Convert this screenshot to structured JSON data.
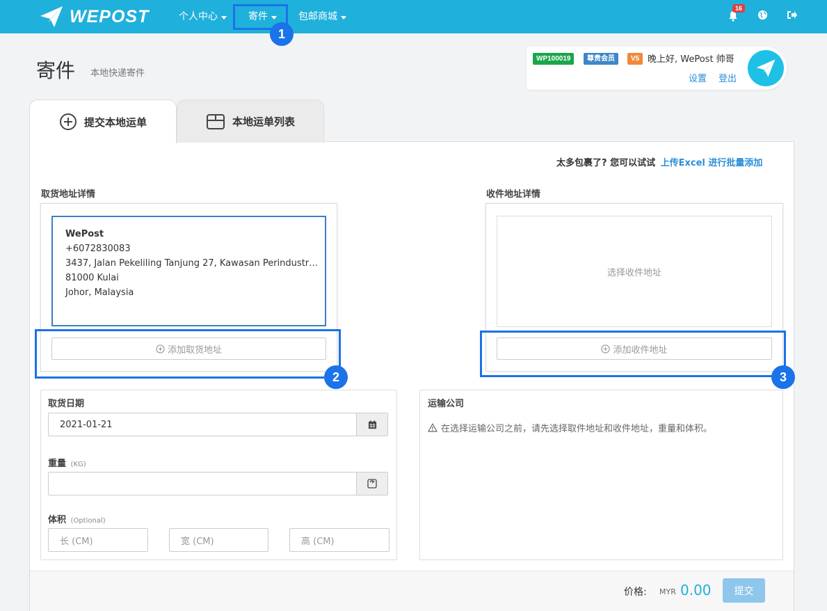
{
  "nav": {
    "logo_text": "WEPOST",
    "items": [
      {
        "label": "个人中心"
      },
      {
        "label": "寄件"
      },
      {
        "label": "包邮商城"
      }
    ],
    "notification_count": "16",
    "brand_color": "#20b0dc"
  },
  "annotations": {
    "step1": "1",
    "step2": "2",
    "step3": "3",
    "highlight_color": "#1a73e8"
  },
  "page": {
    "title": "寄件",
    "subtitle": "本地快递寄件"
  },
  "user": {
    "id_badge": "WP100019",
    "member_badge": "尊贵会员",
    "level_badge": "V5",
    "greeting": "晚上好, WePost 帅哥",
    "settings": "设置",
    "logout": "登出"
  },
  "tabs": [
    {
      "label": "提交本地运单",
      "icon": "plus-circle-icon",
      "active": true
    },
    {
      "label": "本地运单列表",
      "icon": "box-icon",
      "active": false
    }
  ],
  "bulk": {
    "text": "太多包裹了? 您可以试试",
    "link": "上传Excel 进行批量添加"
  },
  "pickup": {
    "section_label": "取货地址详情",
    "name": "WePost",
    "phone": "+6072830083",
    "address1": "3437, Jalan Pekeliling Tanjung 27, Kawasan Perindustrian...",
    "address2": "81000 Kulai",
    "address3": "Johor, Malaysia",
    "add_button": "添加取货地址"
  },
  "recipient": {
    "section_label": "收件地址详情",
    "placeholder": "选择收件地址",
    "add_button": "添加收件地址"
  },
  "form": {
    "date_label": "取货日期",
    "date_value": "2021-01-21",
    "weight_label": "重量",
    "weight_unit": "(KG)",
    "volume_label": "体积",
    "volume_optional": "(Optional)",
    "length_placeholder": "长 (CM)",
    "width_placeholder": "宽 (CM)",
    "height_placeholder": "高 (CM)"
  },
  "courier": {
    "label": "运输公司",
    "warning": "在选择运输公司之前，请先选择取件地址和收件地址，重量和体积。"
  },
  "footer": {
    "price_label": "价格:",
    "currency": "MYR",
    "price": "0.00",
    "submit": "提交"
  }
}
